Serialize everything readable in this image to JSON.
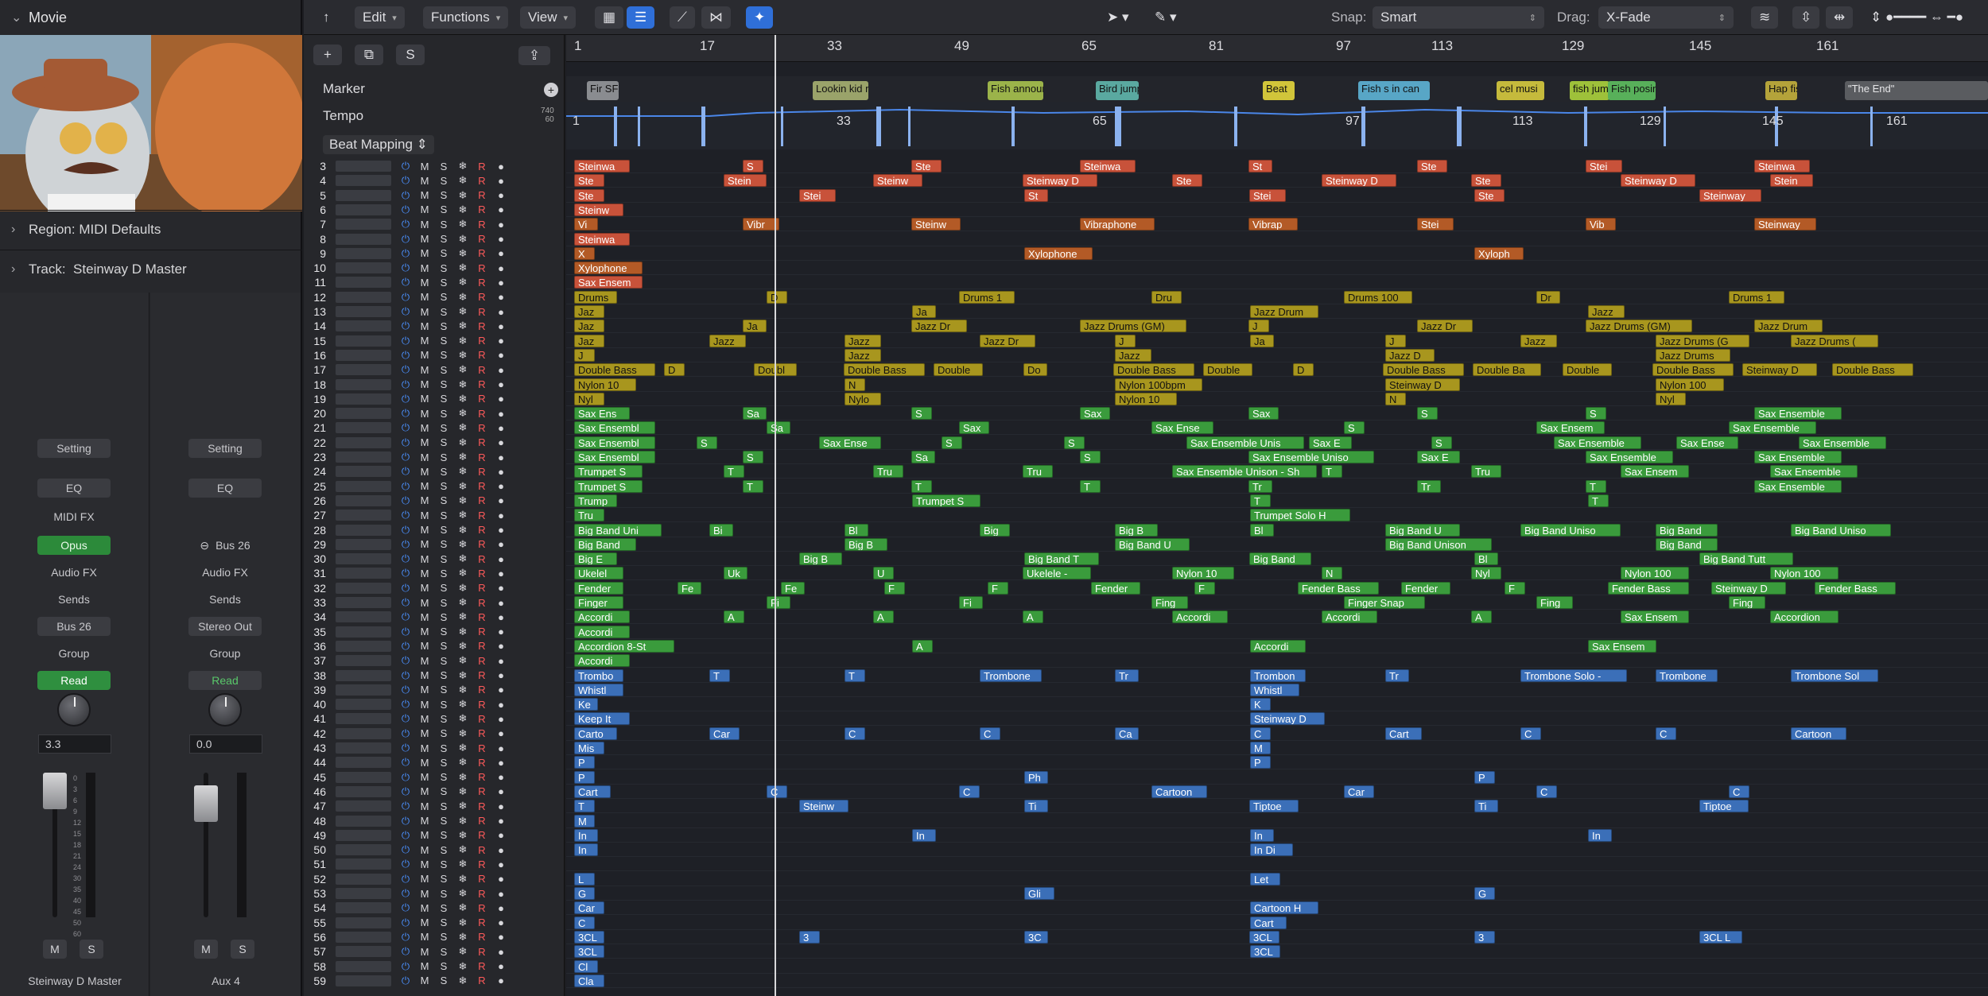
{
  "inspector": {
    "movie_label": "Movie",
    "region_label": "Region:",
    "region_value": "MIDI Defaults",
    "track_label": "Track:",
    "track_value": "Steinway D Master",
    "strip1": {
      "setting": "Setting",
      "eq": "EQ",
      "midi_fx": "MIDI FX",
      "instrument": "Opus",
      "audio_fx": "Audio FX",
      "sends": "Sends",
      "output": "Bus 26",
      "group": "Group",
      "automation": "Read",
      "pan_value": "3.3",
      "mute": "M",
      "solo": "S",
      "name": "Steinway D Master"
    },
    "strip2": {
      "setting": "Setting",
      "eq": "EQ",
      "input": "Bus 26",
      "audio_fx": "Audio FX",
      "sends": "Sends",
      "output": "Stereo Out",
      "group": "Group",
      "automation": "Read",
      "pan_value": "0.0",
      "mute": "M",
      "solo": "S",
      "name": "Aux 4"
    },
    "fader_scale": [
      "0",
      "3",
      "6",
      "9",
      "12",
      "15",
      "18",
      "21",
      "24",
      "30",
      "35",
      "40",
      "45",
      "50",
      "60"
    ]
  },
  "toolbar": {
    "edit": "Edit",
    "functions": "Functions",
    "view": "View",
    "snap_label": "Snap:",
    "snap_value": "Smart",
    "drag_label": "Drag:",
    "drag_value": "X-Fade"
  },
  "global_tracks": {
    "marker": "Marker",
    "tempo": "Tempo",
    "tempo_hi": "740",
    "tempo_lo": "60",
    "beat_mapping": "Beat Mapping"
  },
  "ruler": [
    "1",
    "17",
    "33",
    "49",
    "65",
    "81",
    "97",
    "113",
    "129",
    "145",
    "161"
  ],
  "tempo_numbers": [
    "1",
    "33",
    "65",
    "97",
    "113",
    "129",
    "145",
    "161"
  ],
  "markers": [
    "Fir SFX",
    "Lookin kid ru",
    "Fish announce",
    "Bird jumps",
    "Beat",
    "Fish s in can",
    "cel musi",
    "fish jumps",
    "Fish posing",
    "Hap fish",
    "\"The End\""
  ],
  "track_numbers": [
    "3",
    "4",
    "5",
    "6",
    "7",
    "8",
    "9",
    "10",
    "11",
    "12",
    "13",
    "14",
    "15",
    "16",
    "17",
    "18",
    "19",
    "20",
    "21",
    "22",
    "23",
    "24",
    "25",
    "26",
    "27",
    "28",
    "29",
    "30",
    "31",
    "32",
    "33",
    "34",
    "35",
    "36",
    "37",
    "38",
    "39",
    "40",
    "41",
    "42",
    "43",
    "44",
    "45",
    "46",
    "47",
    "48",
    "49",
    "50",
    "51",
    "52",
    "53",
    "54",
    "55",
    "56",
    "57",
    "58",
    "59"
  ],
  "track_buttons": {
    "mute": "M",
    "solo": "S",
    "freeze": "❄",
    "record": "R"
  },
  "regions": {
    "r3": [
      "Steinwa",
      "S",
      "Ste",
      "Steinwa",
      "St",
      "Ste",
      "Stei",
      "Steinwa"
    ],
    "r4": [
      "Ste",
      "Stein",
      "Steinw",
      "Steinway D",
      "Ste",
      "Steinway D",
      "Ste",
      "Steinway D",
      "Stein"
    ],
    "r5": [
      "Ste",
      "Stei",
      "St",
      "Stei",
      "Ste",
      "Steinway"
    ],
    "r6": [
      "Steinw"
    ],
    "r7": [
      "Vi",
      "Vibr",
      "Steinw",
      "Vibraphone",
      "Vibrap",
      "Stei",
      "Vib",
      "Steinway"
    ],
    "r8": [
      "Steinwa"
    ],
    "r9": [
      "X",
      "Xylophone",
      "Xyloph"
    ],
    "r10": [
      "Xylophone"
    ],
    "r11": [
      "Sax Ensem"
    ],
    "r12": [
      "Drums",
      "D",
      "Drums 1",
      "Dru",
      "Drums 100",
      "Dr",
      "Drums 1"
    ],
    "r13": [
      "Jaz",
      "Ja",
      "Jazz Drum",
      "Jazz"
    ],
    "r14": [
      "Jaz",
      "Ja",
      "Jazz Dr",
      "Jazz Drums (GM)",
      "J",
      "Jazz Dr",
      "Jazz Drums (GM)",
      "Jazz Drum"
    ],
    "r15": [
      "Jaz",
      "Jazz",
      "Jazz",
      "Jazz Dr",
      "J",
      "Ja",
      "J",
      "Jazz",
      "Jazz Drums (G",
      "Jazz Drums ("
    ],
    "r16": [
      "J",
      "Jazz",
      "Jazz",
      "Jazz D",
      "Jazz Drums"
    ],
    "r17": [
      "Double Bass",
      "D",
      "Doubl",
      "Double Bass",
      "Double",
      "Do",
      "Double Bass",
      "Double",
      "D",
      "Double Bass",
      "Double Ba",
      "Double",
      "Double Bass",
      "Steinway D",
      "Double Bass"
    ],
    "r18": [
      "Nylon 10",
      "N",
      "Nylon 100bpm",
      "Steinway D",
      "Nylon 100"
    ],
    "r19": [
      "Nyl",
      "Nylo",
      "Nylon 10",
      "N",
      "Nyl"
    ],
    "r20": [
      "Sax Ens",
      "Sa",
      "S",
      "Sax",
      "Sax",
      "S",
      "S",
      "Sax Ensemble"
    ],
    "r21": [
      "Sax Ensembl",
      "Sa",
      "Sax",
      "Sax Ense",
      "S",
      "Sax Ensem",
      "Sax Ensemble"
    ],
    "r22": [
      "Sax Ensembl",
      "S",
      "Sax Ense",
      "S",
      "S",
      "Sax Ensemble Unis",
      "Sax E",
      "S",
      "Sax Ensemble",
      "Sax Ense",
      "Sax Ensemble"
    ],
    "r23": [
      "Sax Ensembl",
      "S",
      "Sa",
      "S",
      "Sax Ensemble Uniso",
      "Sax E",
      "Sax Ensemble",
      "Sax Ensemble"
    ],
    "r24": [
      "Trumpet S",
      "T",
      "Tru",
      "Tru",
      "Sax Ensemble Unison - Sh",
      "T",
      "Tru",
      "Sax Ensem",
      "Sax Ensemble"
    ],
    "r25": [
      "Trumpet S",
      "T",
      "T",
      "T",
      "Tr",
      "Tr",
      "T",
      "Sax Ensemble"
    ],
    "r26": [
      "Trump",
      "Trumpet S",
      "T",
      "T"
    ],
    "r27": [
      "Tru",
      "Trumpet Solo H"
    ],
    "r28": [
      "Big Band Uni",
      "Bi",
      "Bl",
      "Big",
      "Big B",
      "Bl",
      "Big Band U",
      "Big Band Uniso",
      "Big Band",
      "Big Band Uniso"
    ],
    "r29": [
      "Big Band",
      "Big B",
      "Big Band U",
      "Big Band Unison",
      "Big Band"
    ],
    "r30": [
      "Big E",
      "Big B",
      "Big Band T",
      "Big Band",
      "Bl",
      "Big Band Tutt"
    ],
    "r31": [
      "Ukelel",
      "Uk",
      "U",
      "Ukelele -",
      "Nylon 10",
      "N",
      "Nyl",
      "Nylon 100",
      "Nylon 100"
    ],
    "r32": [
      "Fender",
      "Fe",
      "Fe",
      "F",
      "F",
      "Fender",
      "F",
      "Fender Bass",
      "Fender",
      "F",
      "Fender Bass",
      "Steinway D",
      "Fender Bass"
    ],
    "r33": [
      "Finger",
      "Fi",
      "Fi",
      "Fing",
      "Finger Snap",
      "Fing",
      "Fing"
    ],
    "r34": [
      "Accordi",
      "A",
      "A",
      "A",
      "Accordi",
      "Accordi",
      "A",
      "Sax Ensem",
      "Accordion"
    ],
    "r35": [
      "Accordi"
    ],
    "r36": [
      "Accordion 8-St",
      "A",
      "Accordi",
      "Sax Ensem"
    ],
    "r37": [
      "Accordi"
    ],
    "r38": [
      "Trombo",
      "T",
      "T",
      "Trombone",
      "Tr",
      "Trombon",
      "Tr",
      "Trombone Solo -",
      "Trombone",
      "Trombone Sol"
    ],
    "r39": [
      "Whistl",
      "Whistl"
    ],
    "r40": [
      "Ke",
      "K"
    ],
    "r41": [
      "Keep It",
      "Steinway D"
    ],
    "r42": [
      "Carto",
      "Car",
      "C",
      "C",
      "Ca",
      "C",
      "Cart",
      "C",
      "C",
      "Cartoon"
    ],
    "r43": [
      "Mis",
      "M"
    ],
    "r44": [
      "P",
      "P"
    ],
    "r45": [
      "P",
      "Ph",
      "P"
    ],
    "r46": [
      "Cart",
      "C",
      "C",
      "Cartoon",
      "Car",
      "C",
      "C"
    ],
    "r47": [
      "T",
      "Steinw",
      "Ti",
      "Tiptoe",
      "Ti",
      "Tiptoe"
    ],
    "r48": [
      "M"
    ],
    "r49": [
      "In",
      "In",
      "In",
      "In"
    ],
    "r50": [
      "In",
      "In Di"
    ],
    "r52": [
      "L",
      "Let"
    ],
    "r53": [
      "G",
      "Gli",
      "G"
    ],
    "r54": [
      "Car",
      "Cartoon H"
    ],
    "r55": [
      "C",
      "Cart"
    ],
    "r56": [
      "3CL",
      "3",
      "3C",
      "3CL",
      "3",
      "3CL L"
    ],
    "r57": [
      "3CL",
      "3CL"
    ],
    "r58": [
      "Cl"
    ],
    "r59": [
      "Cla"
    ]
  }
}
